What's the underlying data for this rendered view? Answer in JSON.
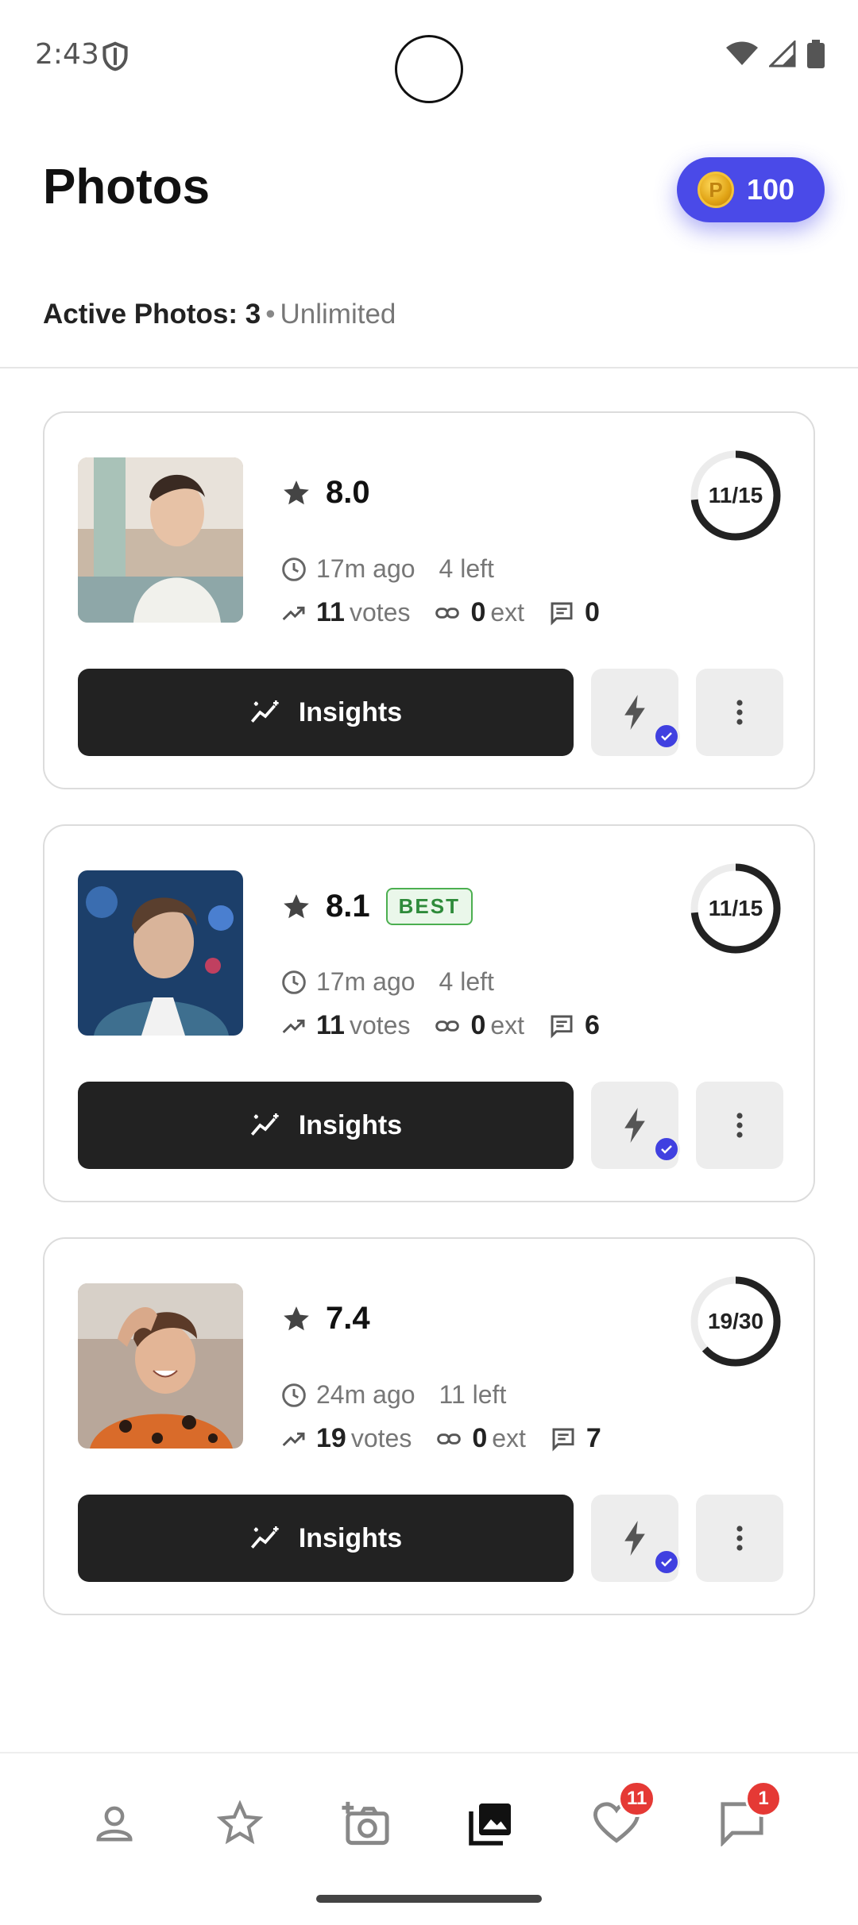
{
  "status_bar": {
    "time": "2:43"
  },
  "header": {
    "title": "Photos",
    "coins": "100",
    "coin_symbol": "P"
  },
  "summary": {
    "label": "Active Photos: 3",
    "separator": "•",
    "plan": "Unlimited"
  },
  "cards": [
    {
      "rating": "8.0",
      "best": "",
      "time": "17m ago",
      "left": "4 left",
      "votes": "11",
      "votes_label": "votes",
      "ext": "0",
      "ext_label": "ext",
      "comments": "0",
      "progress_label": "11/15",
      "progress": 0.7333,
      "button": "Insights"
    },
    {
      "rating": "8.1",
      "best": "BEST",
      "time": "17m ago",
      "left": "4 left",
      "votes": "11",
      "votes_label": "votes",
      "ext": "0",
      "ext_label": "ext",
      "comments": "6",
      "progress_label": "11/15",
      "progress": 0.7333,
      "button": "Insights"
    },
    {
      "rating": "7.4",
      "best": "",
      "time": "24m ago",
      "left": "11 left",
      "votes": "19",
      "votes_label": "votes",
      "ext": "0",
      "ext_label": "ext",
      "comments": "7",
      "progress_label": "19/30",
      "progress": 0.6333,
      "button": "Insights"
    }
  ],
  "nav": {
    "items": [
      "profile-icon",
      "star-icon",
      "add-photo-icon",
      "photos-icon",
      "likes-icon",
      "chat-icon"
    ],
    "likes_badge": "11",
    "chat_badge": "1"
  },
  "colors": {
    "accent": "#4a4ae8",
    "badge": "#e53935",
    "dark_button": "#222222",
    "best_green": "#2e8b3a"
  }
}
